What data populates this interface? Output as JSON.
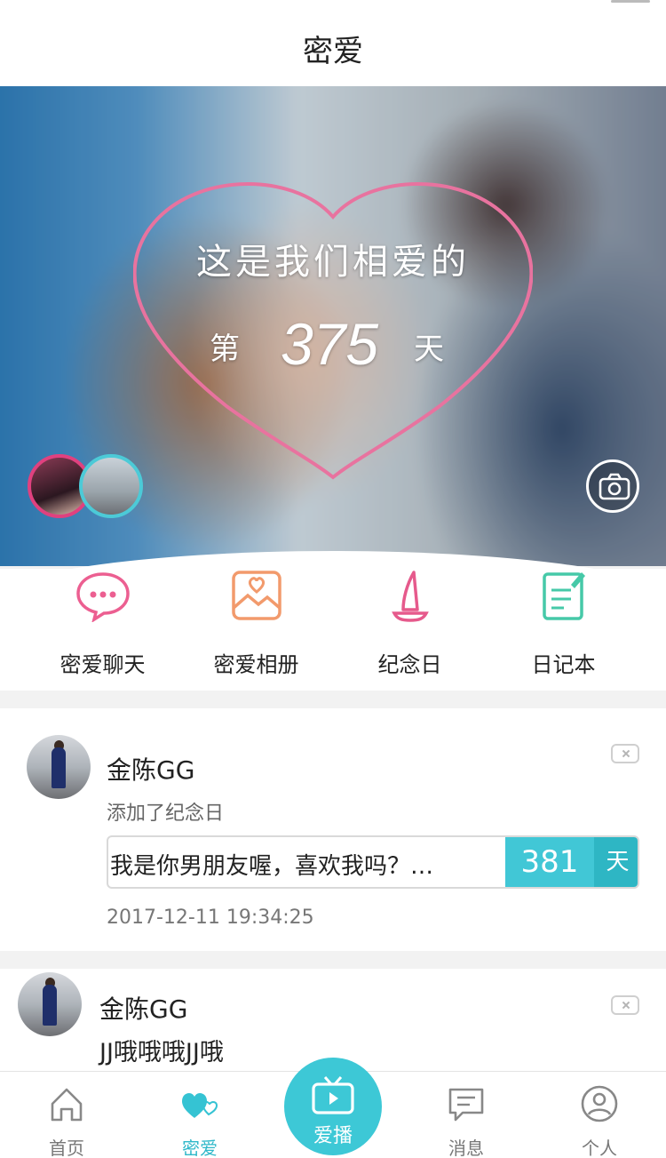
{
  "header": {
    "title": "密爱"
  },
  "hero": {
    "heart_line": "这是我们相爱的",
    "prefix": "第",
    "days": "375",
    "suffix": "天",
    "camera_icon": "camera-icon"
  },
  "quick_actions": [
    {
      "label": "密爱聊天",
      "icon": "chat-bubble-icon",
      "color": "#ec5f91"
    },
    {
      "label": "密爱相册",
      "icon": "photo-album-icon",
      "color": "#f29a6c"
    },
    {
      "label": "纪念日",
      "icon": "sailboat-icon",
      "color": "#e65a8c"
    },
    {
      "label": "日记本",
      "icon": "notebook-icon",
      "color": "#46c9a8"
    }
  ],
  "feed": [
    {
      "user": "金陈GG",
      "action": "添加了纪念日",
      "memo_text": "我是你男朋友喔，喜欢我吗？…",
      "memo_days": "381",
      "memo_unit": "天",
      "timestamp": "2017-12-11 19:34:25"
    },
    {
      "user": "金陈GG",
      "content": "JJ哦哦哦JJ哦"
    }
  ],
  "tabbar": {
    "items": [
      {
        "label": "首页",
        "icon": "home-icon"
      },
      {
        "label": "密爱",
        "icon": "hearts-icon"
      },
      {
        "label": "爱播",
        "icon": "tv-play-icon"
      },
      {
        "label": "消息",
        "icon": "message-icon"
      },
      {
        "label": "个人",
        "icon": "person-icon"
      }
    ],
    "active": "密爱",
    "accent": "#3dc8d6"
  }
}
